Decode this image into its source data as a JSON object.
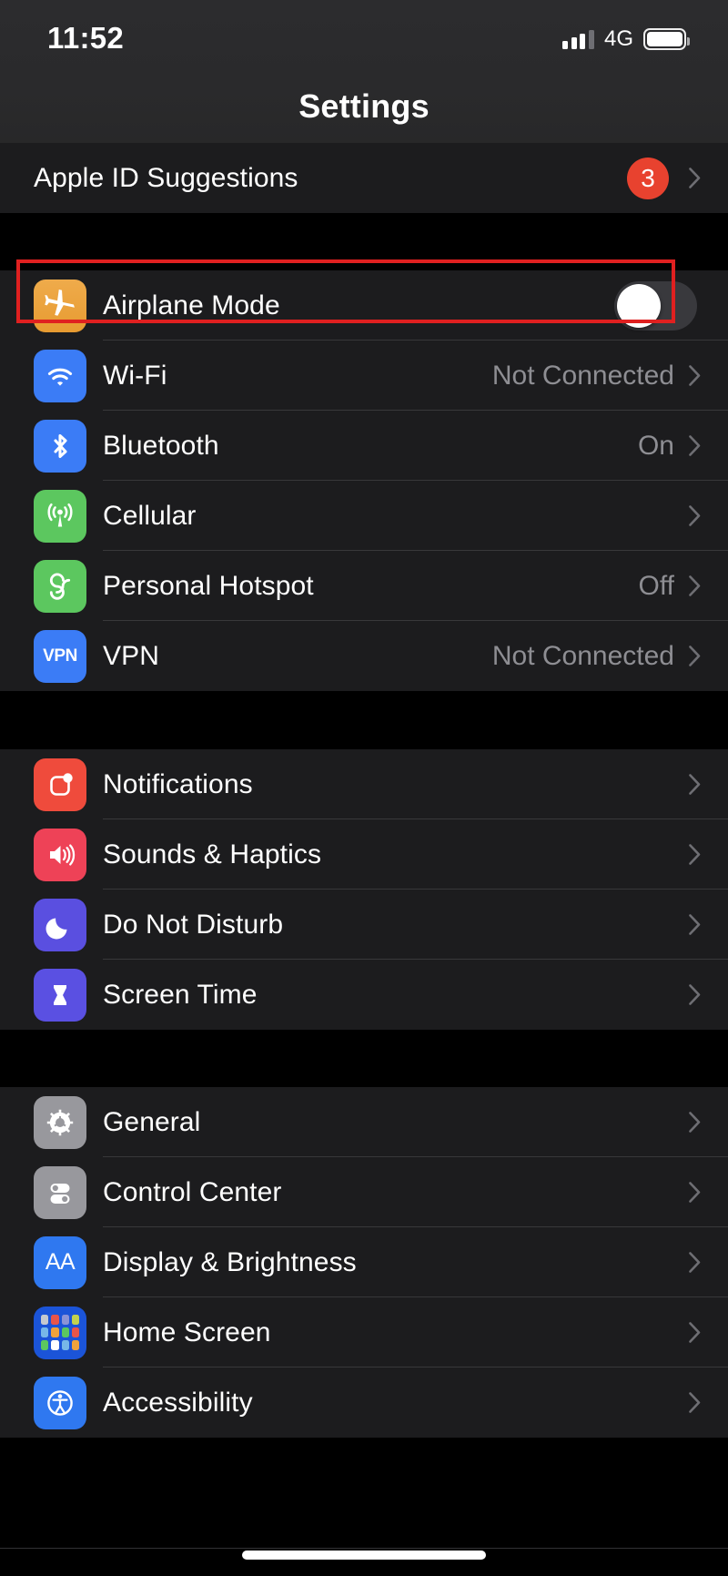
{
  "statusbar": {
    "time": "11:52",
    "network": "4G",
    "signal_icon": "cellular-signal-icon",
    "battery_icon": "battery-full-icon"
  },
  "navbar": {
    "title": "Settings"
  },
  "annotation": {
    "color": "#e02020",
    "target": "Airplane Mode"
  },
  "groups": [
    {
      "id": "apple-id",
      "rows": [
        {
          "label": "Apple ID Suggestions",
          "badge": "3",
          "accessory": "chevron",
          "icon": null
        }
      ]
    },
    {
      "id": "connectivity",
      "rows": [
        {
          "label": "Airplane Mode",
          "icon": "airplane-icon",
          "icon_color": "#e8a33d",
          "accessory": "toggle",
          "toggle_on": false
        },
        {
          "label": "Wi-Fi",
          "icon": "wifi-icon",
          "icon_color": "#3b7cf6",
          "value": "Not Connected",
          "accessory": "chevron"
        },
        {
          "label": "Bluetooth",
          "icon": "bluetooth-icon",
          "icon_color": "#3b7cf6",
          "value": "On",
          "accessory": "chevron"
        },
        {
          "label": "Cellular",
          "icon": "cellular-antenna-icon",
          "icon_color": "#5cc75f",
          "value": "",
          "accessory": "chevron"
        },
        {
          "label": "Personal Hotspot",
          "icon": "hotspot-link-icon",
          "icon_color": "#5cc75f",
          "value": "Off",
          "accessory": "chevron"
        },
        {
          "label": "VPN",
          "icon": "vpn-icon",
          "icon_color": "#3b7cf6",
          "value": "Not Connected",
          "accessory": "chevron"
        }
      ]
    },
    {
      "id": "notifications",
      "rows": [
        {
          "label": "Notifications",
          "icon": "notifications-icon",
          "icon_color": "#ef4b3c",
          "value": "",
          "accessory": "chevron"
        },
        {
          "label": "Sounds & Haptics",
          "icon": "speaker-icon",
          "icon_color": "#ee4257",
          "value": "",
          "accessory": "chevron"
        },
        {
          "label": "Do Not Disturb",
          "icon": "moon-icon",
          "icon_color": "#5a4fe0",
          "value": "",
          "accessory": "chevron"
        },
        {
          "label": "Screen Time",
          "icon": "hourglass-icon",
          "icon_color": "#5a50e2",
          "value": "",
          "accessory": "chevron"
        }
      ]
    },
    {
      "id": "general",
      "rows": [
        {
          "label": "General",
          "icon": "gear-icon",
          "icon_color": "#98989d",
          "value": "",
          "accessory": "chevron"
        },
        {
          "label": "Control Center",
          "icon": "control-center-icon",
          "icon_color": "#98989d",
          "value": "",
          "accessory": "chevron"
        },
        {
          "label": "Display & Brightness",
          "icon": "display-brightness-icon",
          "icon_color": "#2f78f0",
          "value": "",
          "accessory": "chevron"
        },
        {
          "label": "Home Screen",
          "icon": "home-screen-icon",
          "icon_color": "#1b54d8",
          "value": "",
          "accessory": "chevron"
        },
        {
          "label": "Accessibility",
          "icon": "accessibility-icon",
          "icon_color": "#2f78f0",
          "value": "",
          "accessory": "chevron"
        }
      ]
    }
  ],
  "home_indicator": "home-indicator"
}
